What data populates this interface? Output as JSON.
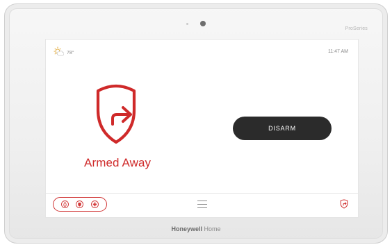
{
  "device": {
    "brand_corner": "ProSeries",
    "brand_name": "Honeywell",
    "brand_suffix": "Home"
  },
  "status_bar": {
    "weather_icon": "sun-cloud-icon",
    "temperature": "78°",
    "time": "11:47 AM"
  },
  "main": {
    "status_icon": "armed-away-shield-icon",
    "status_label": "Armed Away",
    "disarm_label": "DISARM"
  },
  "footer": {
    "emergency_icons": [
      "fire-icon",
      "police-shield-icon",
      "medical-icon"
    ],
    "menu_icon": "menu-icon",
    "quick_icon": "arm-away-icon"
  },
  "colors": {
    "accent_red": "#cf2a2a",
    "button_dark": "#2b2b2b"
  }
}
